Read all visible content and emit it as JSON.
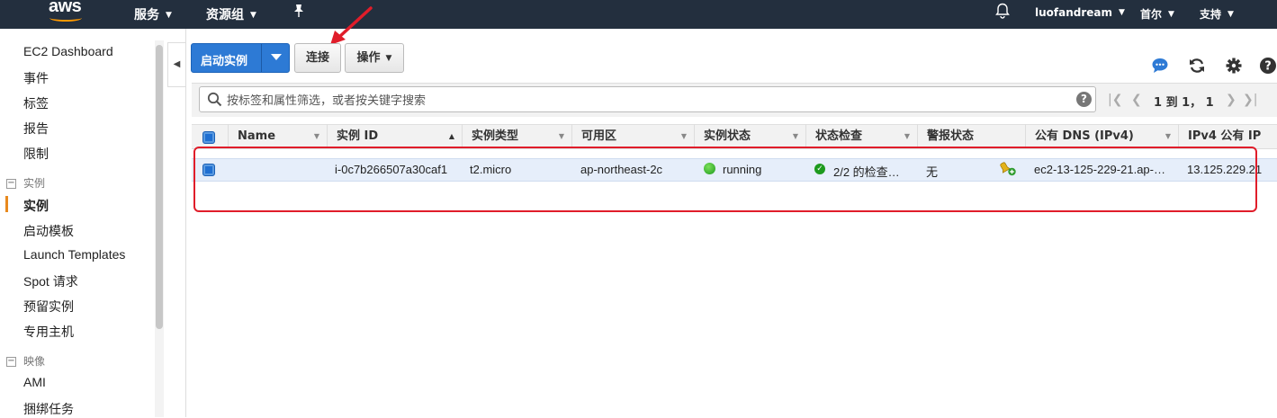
{
  "topnav": {
    "logo": "aws",
    "services": "服务",
    "resource_groups": "资源组",
    "user": "luofandream",
    "region": "首尔",
    "support": "支持"
  },
  "sidebar": {
    "items_top": [
      "EC2 Dashboard",
      "事件",
      "标签",
      "报告",
      "限制"
    ],
    "section_instances": "实例",
    "instances_items": [
      "实例",
      "启动模板",
      "Launch Templates",
      "Spot 请求",
      "预留实例",
      "专用主机"
    ],
    "section_images": "映像",
    "images_items": [
      "AMI",
      "捆绑任务"
    ]
  },
  "toolbar": {
    "launch_label": "启动实例",
    "connect_label": "连接",
    "actions_label": "操作"
  },
  "search": {
    "placeholder": "按标签和属性筛选，或者按关键字搜索",
    "help": "?"
  },
  "pagination": {
    "text": "1 到 1， 1"
  },
  "table": {
    "headers": [
      "Name",
      "实例 ID",
      "实例类型",
      "可用区",
      "实例状态",
      "状态检查",
      "警报状态",
      "公有 DNS (IPv4)",
      "IPv4 公有 IP"
    ],
    "row": {
      "name": "",
      "instance_id": "i-0c7b266507a30caf1",
      "instance_type": "t2.micro",
      "availability_zone": "ap-northeast-2c",
      "instance_state": "running",
      "status_check": "2/2 的检查…",
      "alarm_status": "无",
      "public_dns": "ec2-13-125-229-21.ap-…",
      "public_ip": "13.125.229.21"
    }
  },
  "colors": {
    "nav_bg": "#232f3e",
    "primary_button": "#2d7ad5",
    "running": "#1d9a1d",
    "highlight": "#e01d2a",
    "active_marker": "#e8891d"
  }
}
